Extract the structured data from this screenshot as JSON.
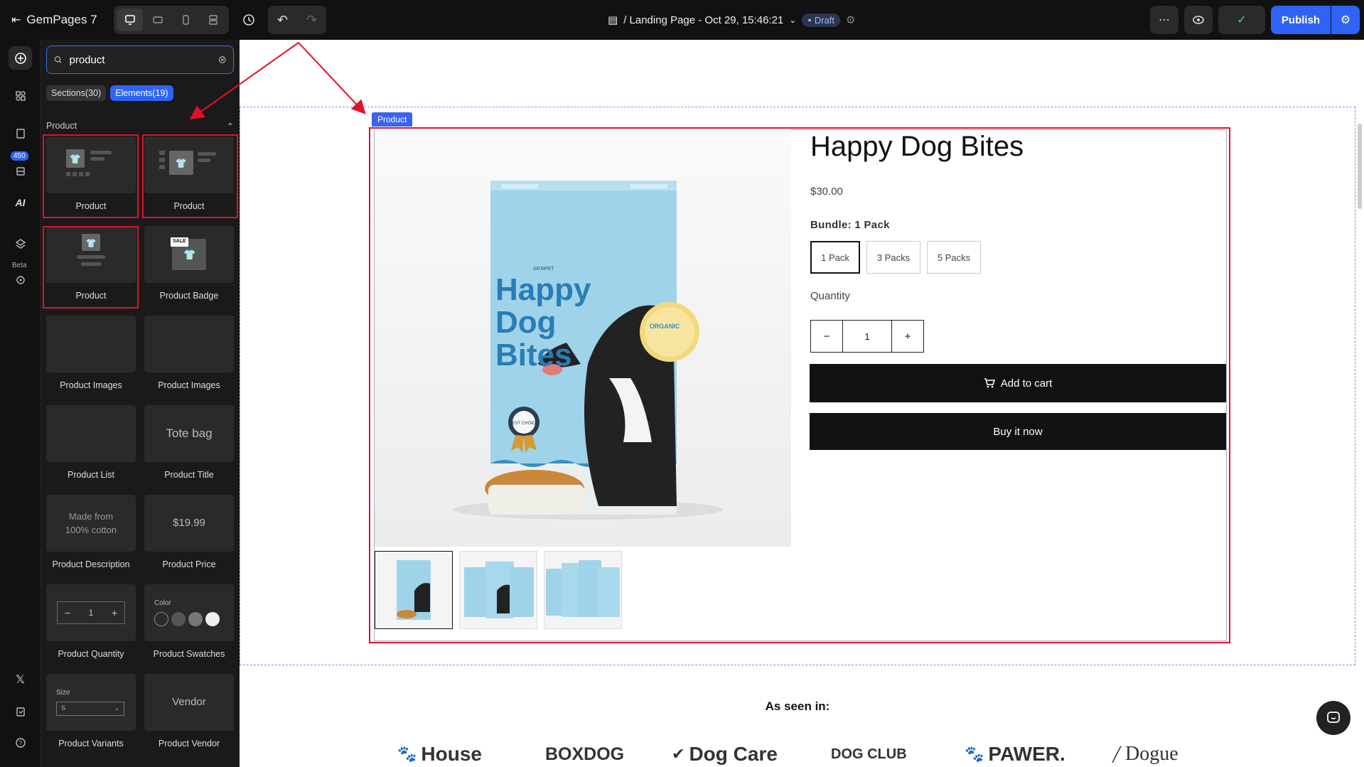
{
  "topbar": {
    "logo_text": "GemPages 7",
    "page_title": "/ Landing Page - Oct 29, 15:46:21",
    "draft_label": "Draft",
    "publish_label": "Publish"
  },
  "rail": {
    "badge_count": "450",
    "ai_label": "AI",
    "beta_label": "Beta"
  },
  "panel": {
    "search_value": "product",
    "tabs": [
      {
        "label": "Sections(30)"
      },
      {
        "label": "Elements(19)"
      }
    ],
    "section_label": "Product",
    "cards": [
      {
        "label": "Product"
      },
      {
        "label": "Product"
      },
      {
        "label": "Product"
      },
      {
        "label": "Product Badge",
        "thumb_text": "SALE"
      },
      {
        "label": "Product Images"
      },
      {
        "label": "Product Images"
      },
      {
        "label": "Product List"
      },
      {
        "label": "Product Title",
        "thumb_text": "Tote bag"
      },
      {
        "label": "Product Description",
        "thumb_text": "Made from 100% cotton"
      },
      {
        "label": "Product Price",
        "thumb_text": "$19.99"
      },
      {
        "label": "Product Quantity",
        "thumb_text": "1"
      },
      {
        "label": "Product Swatches",
        "thumb_text": "Color"
      },
      {
        "label": "Product Variants",
        "thumb_text": "Size",
        "thumb_select": "S"
      },
      {
        "label": "Product Vendor",
        "thumb_text": "Vendor"
      }
    ]
  },
  "canvas": {
    "product_tag": "Product",
    "product": {
      "title": "Happy Dog Bites",
      "price": "$30.00",
      "bundle_label": "Bundle: 1 Pack",
      "options": [
        "1 Pack",
        "3 Packs",
        "5 Packs"
      ],
      "quantity_label": "Quantity",
      "quantity_value": "1",
      "add_to_cart": "Add to cart",
      "buy_now": "Buy it now",
      "bag_text": [
        "Happy",
        "Dog",
        "Bites"
      ],
      "bag_brand": "GEMPET",
      "bag_organic": "ORGANIC",
      "bag_best": "BEST CHOICE"
    },
    "seen_in": "As seen in:",
    "brands": [
      "House",
      "BOXDOG",
      "Dog Care",
      "DOG CLUB",
      "PAWER.",
      "Dogue"
    ]
  },
  "colors": {
    "accent": "#2f63f6",
    "highlight": "#e3102a",
    "dark": "#111111"
  }
}
